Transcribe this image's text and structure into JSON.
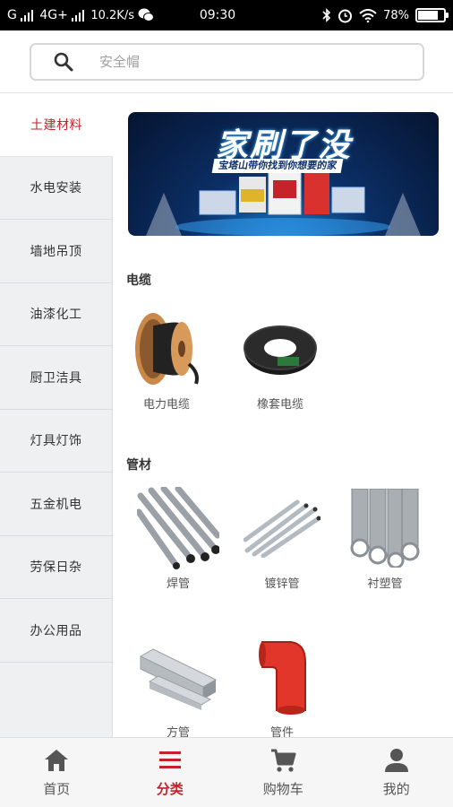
{
  "status_bar": {
    "carrier_g": "G",
    "network": "4G+",
    "speed": "10.2K/s",
    "time": "09:30",
    "battery": "78%",
    "battery_level": 0.78
  },
  "search": {
    "placeholder": "安全帽"
  },
  "sidebar": {
    "items": [
      {
        "label": "土建材料",
        "active": true
      },
      {
        "label": "水电安装"
      },
      {
        "label": "墙地吊顶"
      },
      {
        "label": "油漆化工"
      },
      {
        "label": "厨卫洁具"
      },
      {
        "label": "灯具灯饰"
      },
      {
        "label": "五金机电"
      },
      {
        "label": "劳保日杂"
      },
      {
        "label": "办公用品"
      }
    ]
  },
  "banner": {
    "title": "家刷了没",
    "subtitle": "宝塔山带你找到你想要的家"
  },
  "sections": [
    {
      "title": "电缆",
      "products": [
        {
          "label": "电力电缆",
          "icon": "cable-reel-icon"
        },
        {
          "label": "橡套电缆",
          "icon": "cable-coil-icon"
        }
      ]
    },
    {
      "title": "管材",
      "products": [
        {
          "label": "焊管",
          "icon": "welded-pipe-icon"
        },
        {
          "label": "镀锌管",
          "icon": "galvanized-pipe-icon"
        },
        {
          "label": "衬塑管",
          "icon": "lined-pipe-icon"
        },
        {
          "label": "方管",
          "icon": "square-tube-icon"
        },
        {
          "label": "管件",
          "icon": "pipe-fitting-icon"
        }
      ]
    }
  ],
  "bottom_nav": [
    {
      "label": "首页",
      "icon": "home-icon"
    },
    {
      "label": "分类",
      "icon": "category-icon",
      "active": true
    },
    {
      "label": "购物车",
      "icon": "cart-icon"
    },
    {
      "label": "我的",
      "icon": "user-icon"
    }
  ],
  "colors": {
    "accent": "#c5222b",
    "sidebar_bg": "#eef0f2",
    "banner_bg": "#0b2f66"
  }
}
